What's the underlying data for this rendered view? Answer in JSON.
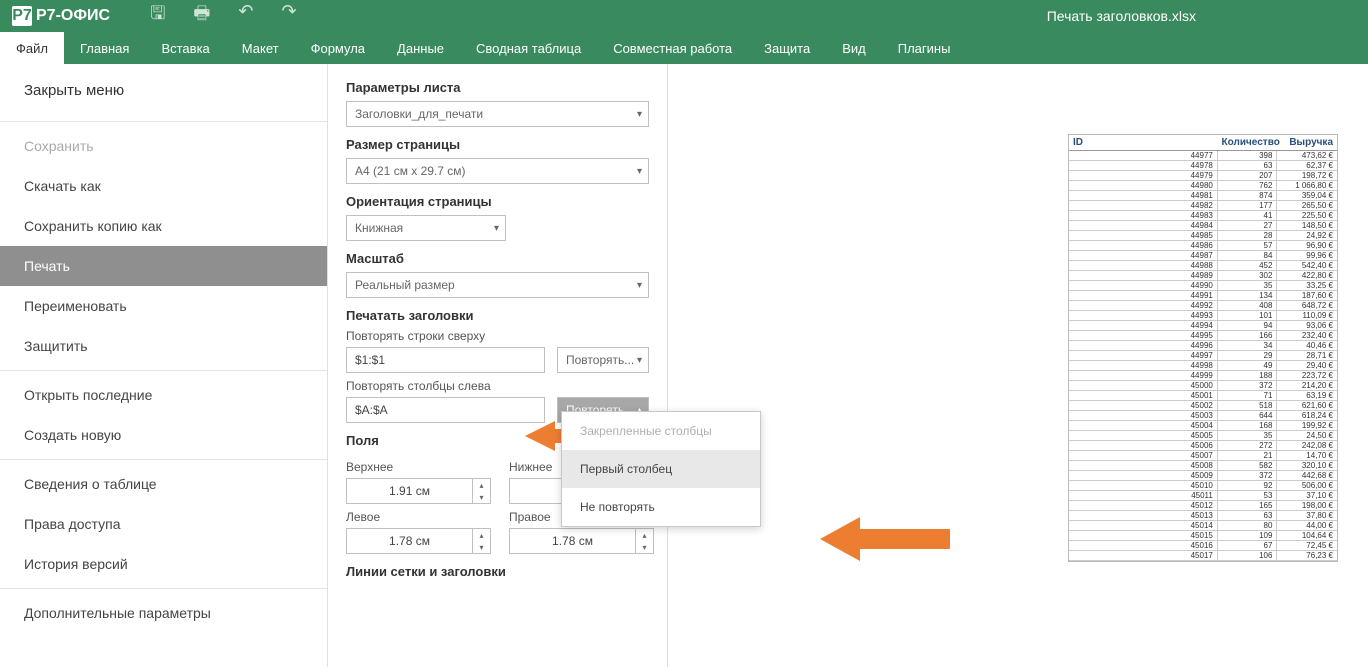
{
  "header": {
    "logo_text": "Р7-ОФИС",
    "title": "Печать заголовков.xlsx"
  },
  "tabs": [
    "Файл",
    "Главная",
    "Вставка",
    "Макет",
    "Формула",
    "Данные",
    "Сводная таблица",
    "Совместная работа",
    "Защита",
    "Вид",
    "Плагины"
  ],
  "sidebar": {
    "close": "Закрыть меню",
    "items1": [
      "Сохранить",
      "Скачать как",
      "Сохранить копию как",
      "Печать",
      "Переименовать",
      "Защитить"
    ],
    "items2": [
      "Открыть последние",
      "Создать новую"
    ],
    "items3": [
      "Сведения о таблице",
      "Права доступа",
      "История версий"
    ],
    "items4": [
      "Дополнительные параметры"
    ]
  },
  "panel": {
    "sheet_params": "Параметры листа",
    "sheet_value": "Заголовки_для_печати",
    "page_size": "Размер страницы",
    "page_size_value": "A4 (21 см x 29.7 см)",
    "orientation": "Ориентация страницы",
    "orientation_value": "Книжная",
    "scale": "Масштаб",
    "scale_value": "Реальный размер",
    "print_titles": "Печатать заголовки",
    "repeat_rows": "Повторять строки сверху",
    "repeat_rows_value": "$1:$1",
    "repeat_cols": "Повторять столбцы слева",
    "repeat_cols_value": "$A:$A",
    "repeat_label": "Повторять...",
    "margins": "Поля",
    "top": "Верхнее",
    "bottom": "Нижнее",
    "left": "Левое",
    "right": "Правое",
    "m_top": "1.91 см",
    "m_bottom": "",
    "m_left": "1.78 см",
    "m_right": "1.78 см",
    "gridlines": "Линии сетки и заголовки"
  },
  "dropdown": {
    "frozen": "Закрепленные столбцы",
    "first": "Первый столбец",
    "none": "Не повторять"
  },
  "preview": {
    "h_id": "ID",
    "h_qty": "Количество",
    "h_rev": "Выручка",
    "rows": [
      [
        "44977",
        "398",
        "473,62 €"
      ],
      [
        "44978",
        "63",
        "62,37 €"
      ],
      [
        "44979",
        "207",
        "198,72 €"
      ],
      [
        "44980",
        "762",
        "1 066,80 €"
      ],
      [
        "44981",
        "874",
        "359,04 €"
      ],
      [
        "44982",
        "177",
        "265,50 €"
      ],
      [
        "44983",
        "41",
        "225,50 €"
      ],
      [
        "44984",
        "27",
        "148,50 €"
      ],
      [
        "44985",
        "28",
        "24,92 €"
      ],
      [
        "44986",
        "57",
        "96,90 €"
      ],
      [
        "44987",
        "84",
        "99,96 €"
      ],
      [
        "44988",
        "452",
        "542,40 €"
      ],
      [
        "44989",
        "302",
        "422,80 €"
      ],
      [
        "44990",
        "35",
        "33,25 €"
      ],
      [
        "44991",
        "134",
        "187,60 €"
      ],
      [
        "44992",
        "408",
        "648,72 €"
      ],
      [
        "44993",
        "101",
        "110,09 €"
      ],
      [
        "44994",
        "94",
        "93,06 €"
      ],
      [
        "44995",
        "166",
        "232,40 €"
      ],
      [
        "44996",
        "34",
        "40,46 €"
      ],
      [
        "44997",
        "29",
        "28,71 €"
      ],
      [
        "44998",
        "49",
        "29,40 €"
      ],
      [
        "44999",
        "188",
        "223,72 €"
      ],
      [
        "45000",
        "372",
        "214,20 €"
      ],
      [
        "45001",
        "71",
        "63,19 €"
      ],
      [
        "45002",
        "518",
        "621,60 €"
      ],
      [
        "45003",
        "644",
        "618,24 €"
      ],
      [
        "45004",
        "168",
        "199,92 €"
      ],
      [
        "45005",
        "35",
        "24,50 €"
      ],
      [
        "45006",
        "272",
        "242,08 €"
      ],
      [
        "45007",
        "21",
        "14,70 €"
      ],
      [
        "45008",
        "582",
        "320,10 €"
      ],
      [
        "45009",
        "372",
        "442,68 €"
      ],
      [
        "45010",
        "92",
        "506,00 €"
      ],
      [
        "45011",
        "53",
        "37,10 €"
      ],
      [
        "45012",
        "165",
        "198,00 €"
      ],
      [
        "45013",
        "63",
        "37,80 €"
      ],
      [
        "45014",
        "80",
        "44,00 €"
      ],
      [
        "45015",
        "109",
        "104,64 €"
      ],
      [
        "45016",
        "67",
        "72,45 €"
      ],
      [
        "45017",
        "106",
        "76,23 €"
      ]
    ]
  }
}
